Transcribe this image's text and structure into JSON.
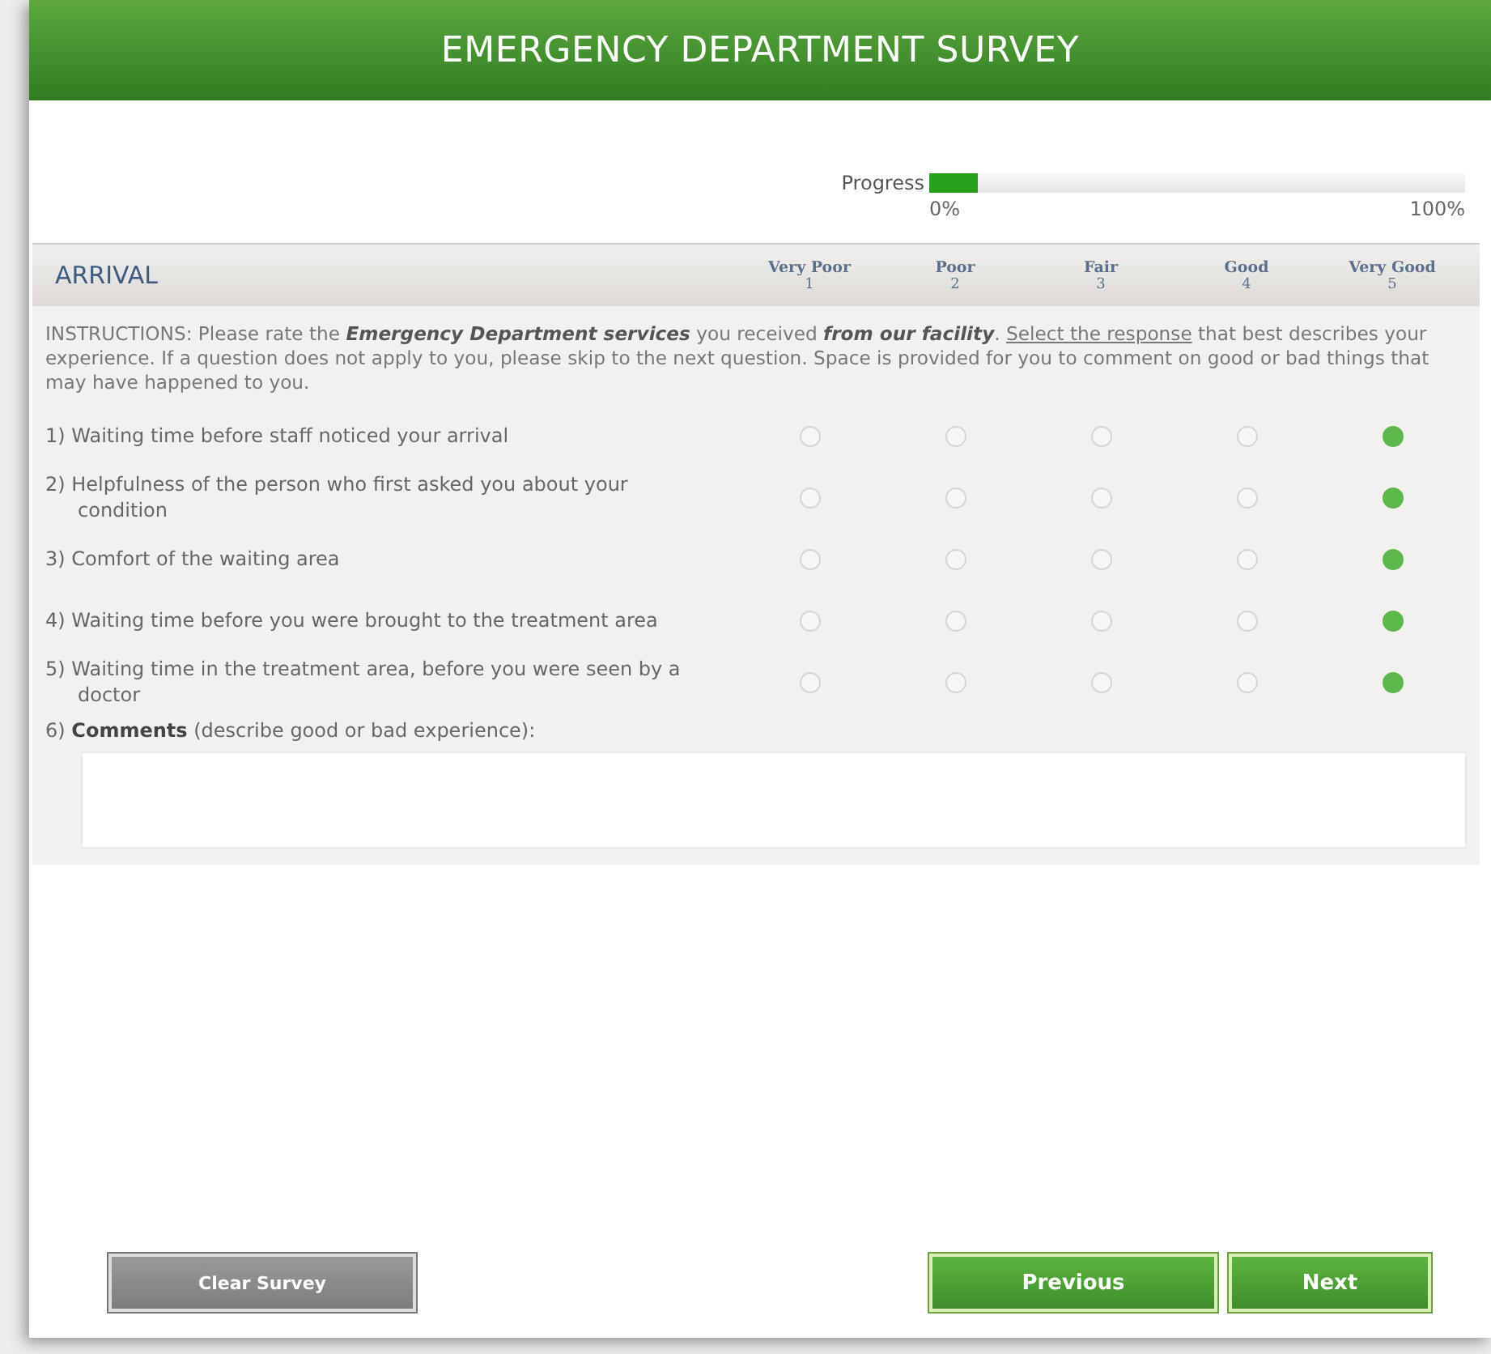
{
  "title": "EMERGENCY DEPARTMENT SURVEY",
  "progress": {
    "label": "Progress",
    "level": 0.09,
    "start": "0%",
    "end": "100%"
  },
  "section": {
    "title": "ARRIVAL",
    "scale": [
      {
        "label": "Very Poor",
        "number": "1"
      },
      {
        "label": "Poor",
        "number": "2"
      },
      {
        "label": "Fair",
        "number": "3"
      },
      {
        "label": "Good",
        "number": "4"
      },
      {
        "label": "Very Good",
        "number": "5"
      }
    ],
    "instructions": {
      "before": "INSTRUCTIONS: Please rate the **Emergency Department services** you received **from our facility**.",
      "link": "Select the response",
      "after": "that best describes your experience. If a question does not apply to you, please skip to the next question. Space is provided for you to comment on good or bad things that may have happened to you."
    },
    "questions": [
      {
        "text": "1) Waiting time before staff noticed your arrival",
        "options": [
          {
            "selected": false
          },
          {
            "selected": false
          },
          {
            "selected": false
          },
          {
            "selected": false
          },
          {
            "selected": true
          }
        ]
      },
      {
        "text": "2) Helpfulness of the person who first asked you about your condition",
        "options": [
          {
            "selected": false
          },
          {
            "selected": false
          },
          {
            "selected": false
          },
          {
            "selected": false
          },
          {
            "selected": true
          }
        ]
      },
      {
        "text": "3) Comfort of the waiting area",
        "options": [
          {
            "selected": false
          },
          {
            "selected": false
          },
          {
            "selected": false
          },
          {
            "selected": false
          },
          {
            "selected": true
          }
        ]
      },
      {
        "text": "4) Waiting time before you were brought to the treatment area",
        "options": [
          {
            "selected": false
          },
          {
            "selected": false
          },
          {
            "selected": false
          },
          {
            "selected": false
          },
          {
            "selected": true
          }
        ]
      },
      {
        "text": "5) Waiting time in the treatment area, before you were seen by a doctor",
        "options": [
          {
            "selected": false
          },
          {
            "selected": false
          },
          {
            "selected": false
          },
          {
            "selected": false
          },
          {
            "selected": true
          }
        ]
      }
    ],
    "comments": {
      "label": "6) **Comments** (describe good or bad experience):"
    }
  },
  "buttons": [
    {
      "label": "Clear Survey",
      "kind": "secondary"
    },
    {
      "label": "Previous",
      "kind": "primary"
    },
    {
      "label": "Next",
      "kind": "primary"
    }
  ]
}
